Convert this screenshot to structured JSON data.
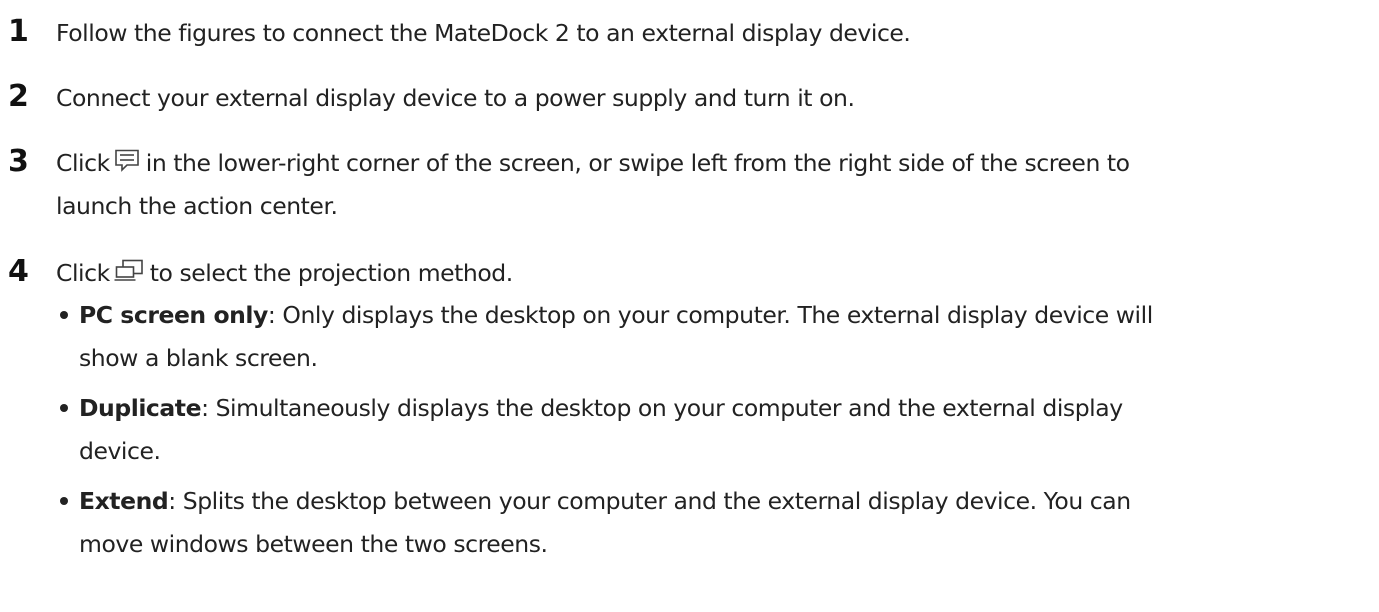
{
  "steps": [
    {
      "number": "1",
      "text": "Follow the figures to connect the MateDock 2 to an external display device."
    },
    {
      "number": "2",
      "text": "Connect your external display device to a power supply and turn it on."
    },
    {
      "number": "3",
      "before_icon": "Click",
      "icon": "action-center-icon",
      "after_icon": "in the lower-right corner of the screen, or swipe left from the right side of the screen to",
      "continuation": "launch the action center."
    },
    {
      "number": "4",
      "before_icon": "Click",
      "icon": "project-icon",
      "after_icon": "to select the projection method.",
      "options": [
        {
          "term": "PC screen only",
          "desc_line1": ": Only displays the desktop on your computer. The external display device will",
          "desc_line2": "show a blank screen."
        },
        {
          "term": "Duplicate",
          "desc_line1": ": Simultaneously displays the desktop on your computer and the external display",
          "desc_line2": "device."
        },
        {
          "term": "Extend",
          "desc_line1": ": Splits the desktop between your computer and the external display device. You can",
          "desc_line2": "move windows between the two screens."
        }
      ]
    }
  ]
}
